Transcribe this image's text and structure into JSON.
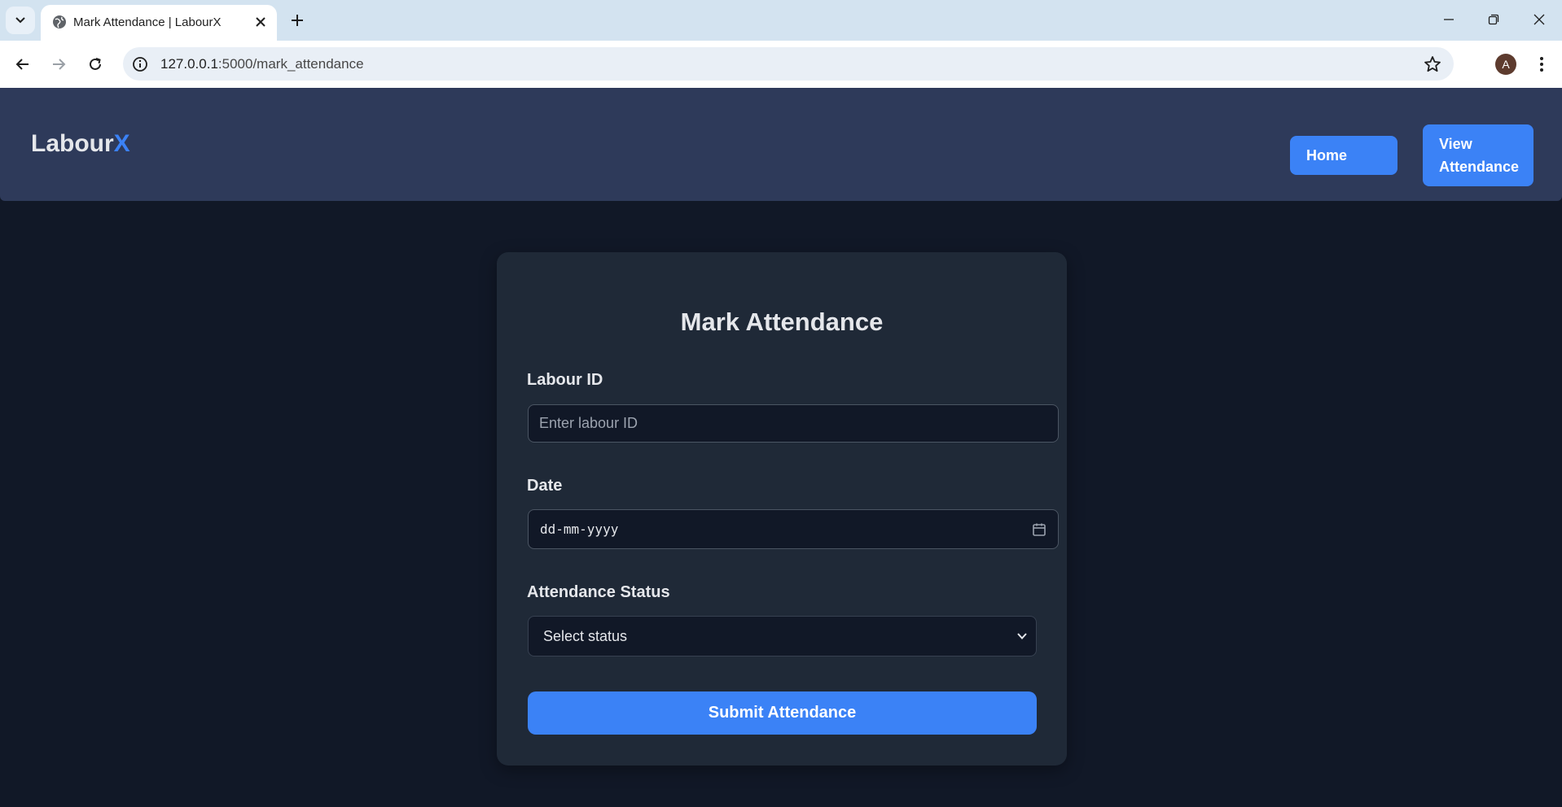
{
  "browser": {
    "tab_title": "Mark Attendance | LabourX",
    "url_host": "127.0.0.1",
    "url_path": ":5000/mark_attendance",
    "profile_initial": "A",
    "icons": [
      "tab-search-icon",
      "globe-icon",
      "close-icon",
      "plus-icon",
      "minimize-icon",
      "restore-icon",
      "close-window-icon",
      "back-icon",
      "forward-icon",
      "reload-icon",
      "site-info-icon",
      "star-icon",
      "more-icon"
    ]
  },
  "header": {
    "logo_main": "Labour",
    "logo_accent": "X",
    "nav": {
      "home_label": "Home",
      "view_line1": "View",
      "view_line2": "Attendance"
    }
  },
  "form": {
    "title": "Mark Attendance",
    "labour_id": {
      "label": "Labour ID",
      "placeholder": "Enter labour ID",
      "value": ""
    },
    "date": {
      "label": "Date",
      "value": "dd-mm-yyyy"
    },
    "status": {
      "label": "Attendance Status",
      "selected": "Select status"
    },
    "submit_label": "Submit Attendance"
  },
  "colors": {
    "page_bg": "#111827",
    "header_bg": "#2e3a5a",
    "card_bg": "#1f2937",
    "accent": "#3b82f6"
  }
}
